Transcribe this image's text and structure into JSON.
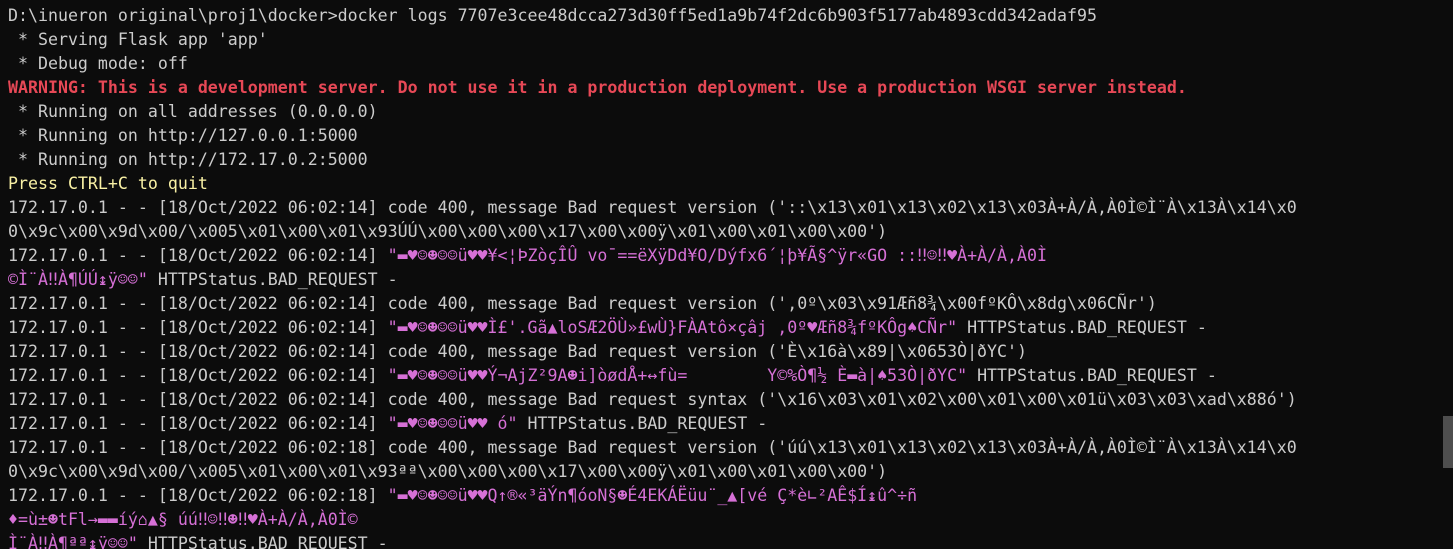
{
  "terminal": {
    "colors": {
      "background": "#0c0c0c",
      "text": "#cccccc",
      "warning": "#e74856",
      "notice": "#f9f1a5",
      "garbled": "#d670d6"
    },
    "lines": [
      {
        "text": "D:\\inueron original\\proj1\\docker>docker logs 7707e3cee48dcca273d30ff5ed1a9b74f2dc6b903f5177ab4893cdd342adaf95"
      },
      {
        "text": " * Serving Flask app 'app'"
      },
      {
        "text": " * Debug mode: off"
      },
      {
        "text": "WARNING: This is a development server. Do not use it in a production deployment. Use a production WSGI server instead."
      },
      {
        "text": " * Running on all addresses (0.0.0.0)"
      },
      {
        "text": " * Running on http://127.0.0.1:5000"
      },
      {
        "text": " * Running on http://172.17.0.2:5000"
      },
      {
        "text": "Press CTRL+C to quit"
      },
      {
        "text": "172.17.0.1 - - [18/Oct/2022 06:02:14] code 400, message Bad request version ('::\\x13\\x01\\x13\\x02\\x13\\x03À+À/À,À0Ì©Ì¨À\\x13À\\x14\\x0"
      },
      {
        "text": "0\\x9c\\x00\\x9d\\x00/\\x005\\x01\\x00\\x01\\x93ÚÚ\\x00\\x00\\x00\\x17\\x00\\x00ÿ\\x01\\x00\\x01\\x00\\x00')"
      },
      {
        "prefix": "172.17.0.1 - - [18/Oct/2022 06:02:14] ",
        "garbled": "\"▬♥☺☻☺☺ü♥♥¥<¦ÞZòçÎÛ vo¯==ëXÿDd¥O/Dýfx6´¦þ¥Ã§^ÿr«GO ::‼☺‼♥À+À/À,À0Ì"
      },
      {
        "garbled": "©Ì¨À‼À¶ÚÚ↨ÿ☺☺\"",
        "suffix": " HTTPStatus.BAD_REQUEST -"
      },
      {
        "text": "172.17.0.1 - - [18/Oct/2022 06:02:14] code 400, message Bad request version (',0º\\x03\\x91Æñ8¾\\x00fºKÔ\\x8dg\\x06CÑr')"
      },
      {
        "prefix": "172.17.0.1 - - [18/Oct/2022 06:02:14] ",
        "garbled": "\"▬♥☺☻☺☺ü♥♥Ì£'.Gã▲loSÆ2ÖÙ»£wÙ}FÀAtô×çâj ,0º♥Æñ8¾fºKÔg♠CÑr\"",
        "suffix": " HTTPStatus.BAD_REQUEST -"
      },
      {
        "text": "172.17.0.1 - - [18/Oct/2022 06:02:14] code 400, message Bad request version ('È\\x16à\\x89|\\x0653Ò|ðYC')"
      },
      {
        "prefix": "172.17.0.1 - - [18/Oct/2022 06:02:14] ",
        "garbled": "\"▬♥☺☻☺☺ü♥♥Ý¬AjZ²9A☻i]òødÅ+↔fù=        Y©%Ò¶½ È▬à|♠53Ò|ðYC\"",
        "suffix": " HTTPStatus.BAD_REQUEST -"
      },
      {
        "text": "172.17.0.1 - - [18/Oct/2022 06:02:14] code 400, message Bad request syntax ('\\x16\\x03\\x01\\x02\\x00\\x01\\x00\\x01ü\\x03\\x03\\xad\\x88ó')"
      },
      {
        "prefix": "172.17.0.1 - - [18/Oct/2022 06:02:14] ",
        "garbled": "\"▬♥☺☻☺☺ü♥♥ ó\"",
        "suffix": " HTTPStatus.BAD_REQUEST -"
      },
      {
        "text": "172.17.0.1 - - [18/Oct/2022 06:02:18] code 400, message Bad request version ('úú\\x13\\x01\\x13\\x02\\x13\\x03À+À/À,À0Ì©Ì¨À\\x13À\\x14\\x0"
      },
      {
        "text": "0\\x9c\\x00\\x9d\\x00/\\x005\\x01\\x00\\x01\\x93ªª\\x00\\x00\\x00\\x17\\x00\\x00ÿ\\x01\\x00\\x01\\x00\\x00')"
      },
      {
        "prefix": "172.17.0.1 - - [18/Oct/2022 06:02:18] ",
        "garbled": "\"▬♥☺☻☺☺ü♥♥Q↑®«³äÝn¶óoN§☻É4EKÁËüu¨_▲[vé Ç*è∟²AÊ$Í↨û^÷ñ"
      },
      {
        "garbled": "♦=ù±☻tFl→▬▬íý⌂▲§ úú‼☺‼☻‼♥À+À/À,À0Ì©"
      },
      {
        "garbled": "Ì¨À‼À¶ªª↨ÿ☺☺\"",
        "suffix": " HTTPStatus.BAD_REQUEST -"
      }
    ]
  }
}
